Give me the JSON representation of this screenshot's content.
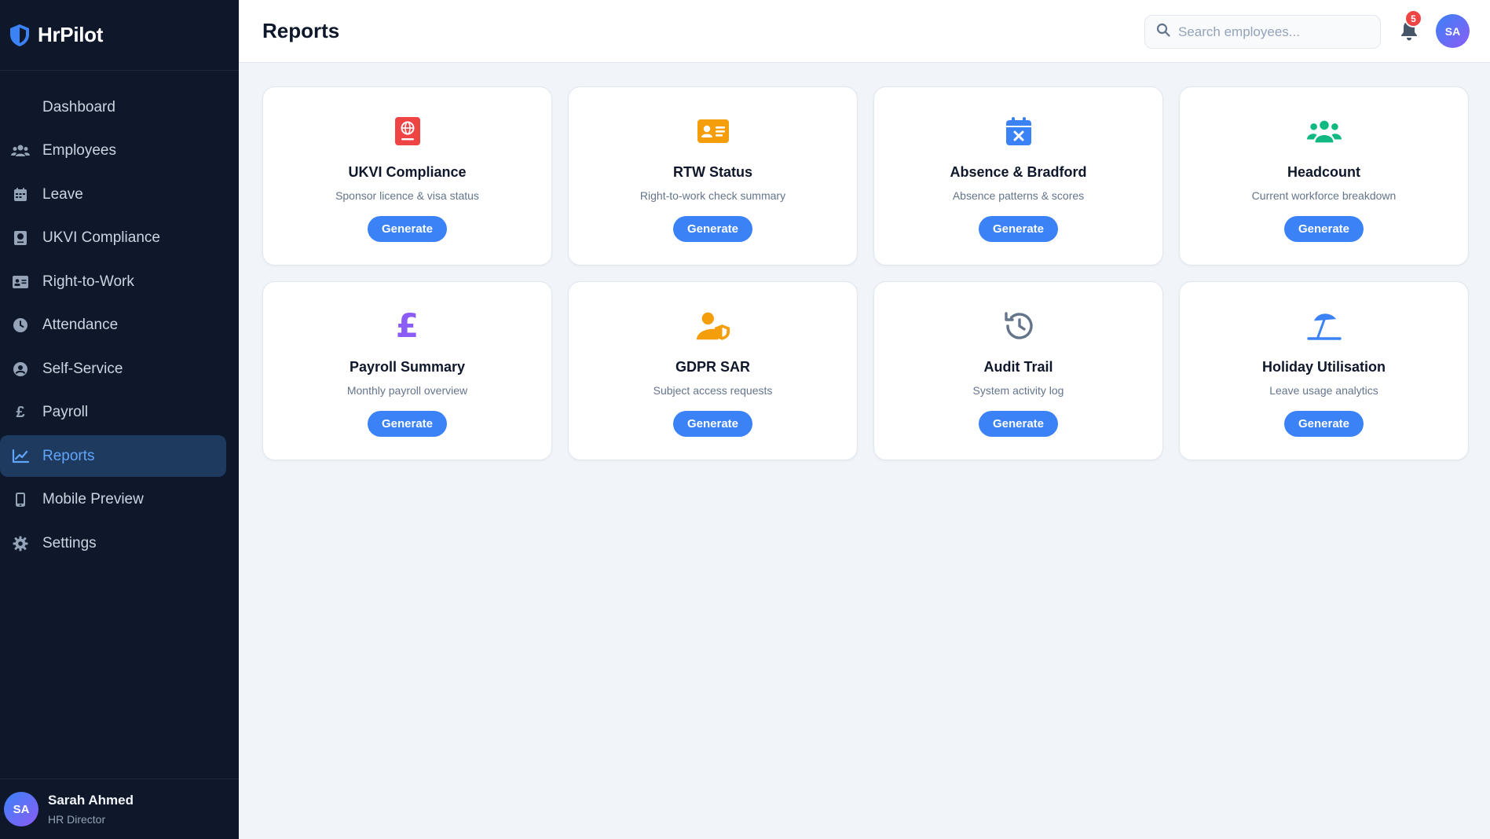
{
  "app": {
    "name": "HrPilot"
  },
  "sidebar": {
    "items": [
      {
        "label": "Dashboard",
        "icon": "dashboard-icon",
        "active": false
      },
      {
        "label": "Employees",
        "icon": "users-icon",
        "active": false
      },
      {
        "label": "Leave",
        "icon": "calendar-icon",
        "active": false
      },
      {
        "label": "UKVI Compliance",
        "icon": "passport-icon",
        "active": false
      },
      {
        "label": "Right-to-Work",
        "icon": "id-card-icon",
        "active": false
      },
      {
        "label": "Attendance",
        "icon": "clock-icon",
        "active": false
      },
      {
        "label": "Self-Service",
        "icon": "user-circle-icon",
        "active": false
      },
      {
        "label": "Payroll",
        "icon": "pound-icon",
        "active": false
      },
      {
        "label": "Reports",
        "icon": "chart-line-icon",
        "active": true
      },
      {
        "label": "Mobile Preview",
        "icon": "mobile-icon",
        "active": false
      },
      {
        "label": "Settings",
        "icon": "gear-icon",
        "active": false
      }
    ],
    "user": {
      "initials": "SA",
      "name": "Sarah Ahmed",
      "role": "HR Director"
    }
  },
  "header": {
    "title": "Reports",
    "search_placeholder": "Search employees...",
    "notification_count": "5",
    "avatar_initials": "SA"
  },
  "reports": [
    {
      "title": "UKVI Compliance",
      "desc": "Sponsor licence & visa status",
      "button": "Generate",
      "icon": "passport-icon",
      "color": "#ef4444"
    },
    {
      "title": "RTW Status",
      "desc": "Right-to-work check summary",
      "button": "Generate",
      "icon": "id-card-icon",
      "color": "#f59e0b"
    },
    {
      "title": "Absence & Bradford",
      "desc": "Absence patterns & scores",
      "button": "Generate",
      "icon": "calendar-x-icon",
      "color": "#3b82f6"
    },
    {
      "title": "Headcount",
      "desc": "Current workforce breakdown",
      "button": "Generate",
      "icon": "users-icon",
      "color": "#10b981"
    },
    {
      "title": "Payroll Summary",
      "desc": "Monthly payroll overview",
      "button": "Generate",
      "icon": "pound-icon",
      "color": "#8b5cf6"
    },
    {
      "title": "GDPR SAR",
      "desc": "Subject access requests",
      "button": "Generate",
      "icon": "user-shield-icon",
      "color": "#f59e0b"
    },
    {
      "title": "Audit Trail",
      "desc": "System activity log",
      "button": "Generate",
      "icon": "history-icon",
      "color": "#64748b"
    },
    {
      "title": "Holiday Utilisation",
      "desc": "Leave usage analytics",
      "button": "Generate",
      "icon": "umbrella-beach-icon",
      "color": "#3b82f6"
    }
  ]
}
